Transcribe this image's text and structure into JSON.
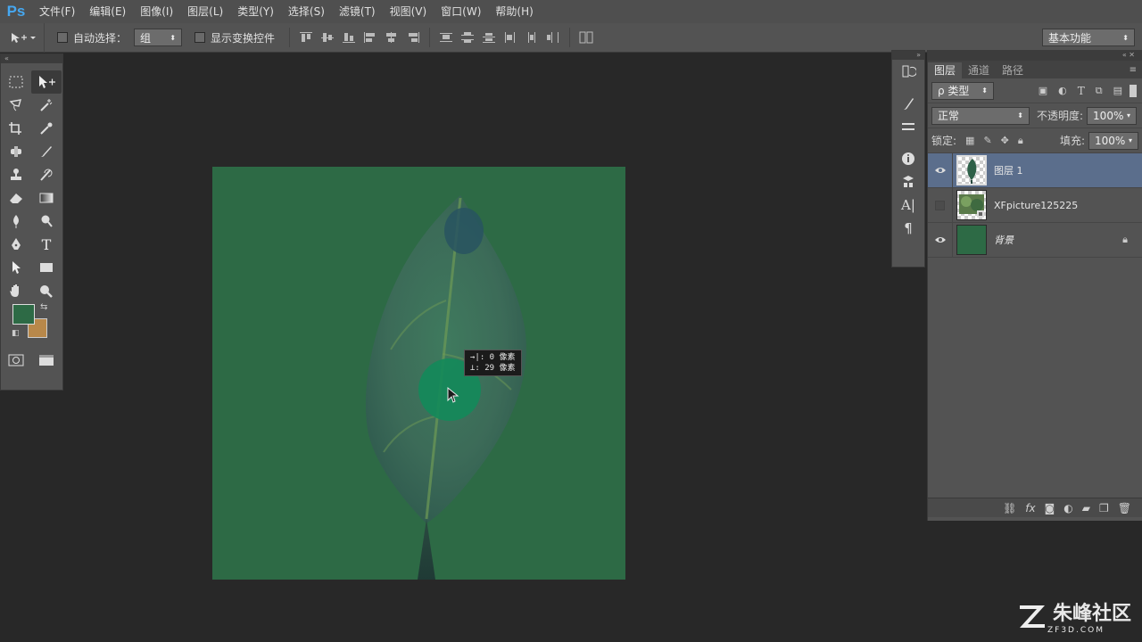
{
  "app": {
    "logo": "Ps"
  },
  "menu": [
    "文件(F)",
    "编辑(E)",
    "图像(I)",
    "图层(L)",
    "类型(Y)",
    "选择(S)",
    "滤镜(T)",
    "视图(V)",
    "窗口(W)",
    "帮助(H)"
  ],
  "options": {
    "auto_select_label": "自动选择：",
    "auto_select_value": "组",
    "show_transform_label": "显示变换控件",
    "workspace": "基本功能"
  },
  "tooltip": {
    "line1": "→|:  0 像素",
    "line2": "⊥: 29 像素"
  },
  "colors": {
    "foreground": "#2d6a45",
    "background": "#b8884a",
    "canvas": "#2d6a45",
    "selected_layer": "#5b6e8c"
  },
  "layers_panel": {
    "tabs": [
      "图层",
      "通道",
      "路径"
    ],
    "filter_label": "ρ 类型",
    "blend_mode": "正常",
    "opacity_label": "不透明度:",
    "opacity_value": "100%",
    "lock_label": "锁定:",
    "fill_label": "填充:",
    "fill_value": "100%",
    "layers": [
      {
        "name": "图层 1",
        "visible": true,
        "selected": true
      },
      {
        "name": "XFpicture125225",
        "visible": false,
        "selected": false
      },
      {
        "name": "背景",
        "visible": true,
        "selected": false,
        "locked": true
      }
    ],
    "bottom_icons": [
      "link-icon",
      "fx-icon",
      "mask-icon",
      "adjustment-icon",
      "folder-icon",
      "new-layer-icon",
      "trash-icon"
    ],
    "fx_label": "fx"
  },
  "watermark": {
    "title": "朱峰社区",
    "sub": "ZF3D.COM"
  }
}
